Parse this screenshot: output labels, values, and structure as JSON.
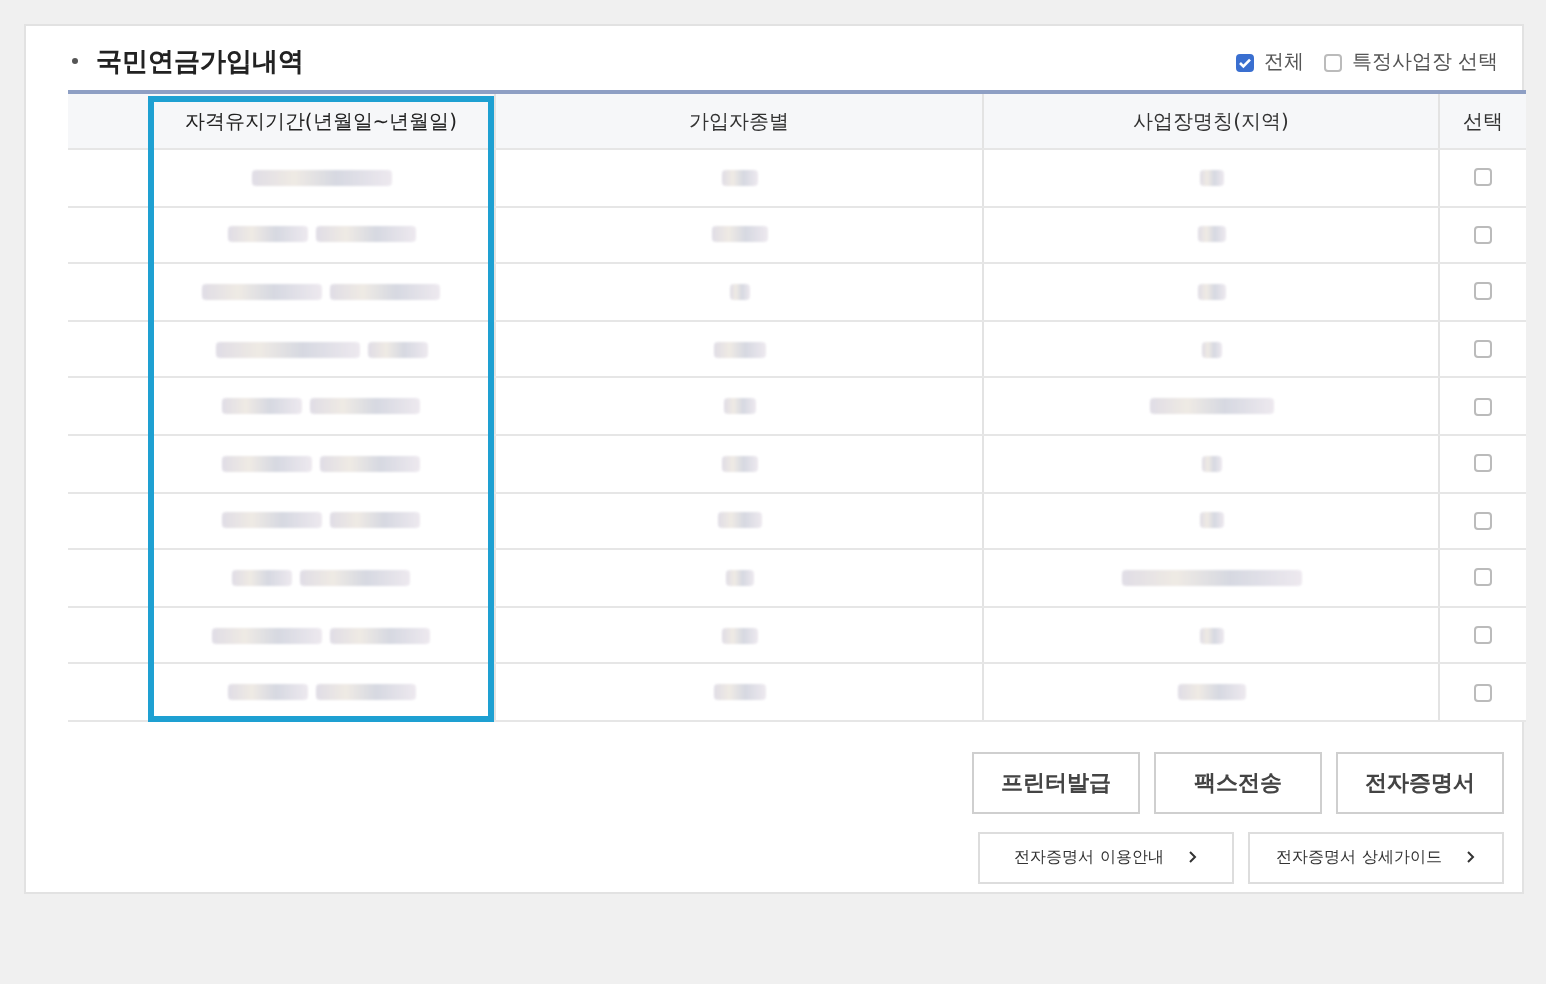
{
  "section": {
    "title": "국민연금가입내역"
  },
  "filters": [
    {
      "label": "전체",
      "checked": true
    },
    {
      "label": "특정사업장 선택",
      "checked": false
    }
  ],
  "table": {
    "columns": [
      {
        "label": "자격유지기간(년월일~년월일)",
        "highlighted": true
      },
      {
        "label": "가입자종별",
        "highlighted": false
      },
      {
        "label": "사업장명칭(지역)",
        "highlighted": false
      },
      {
        "label": "선택",
        "highlighted": false
      }
    ],
    "rows": [
      {
        "selected": false
      },
      {
        "selected": false
      },
      {
        "selected": false
      },
      {
        "selected": false
      },
      {
        "selected": false
      },
      {
        "selected": false
      },
      {
        "selected": false
      },
      {
        "selected": false
      },
      {
        "selected": false
      },
      {
        "selected": false
      }
    ]
  },
  "buttons": [
    "프린터발급",
    "팩스전송",
    "전자증명서"
  ],
  "guide_links": [
    "전자증명서 이용안내",
    "전자증명서 상세가이드"
  ]
}
